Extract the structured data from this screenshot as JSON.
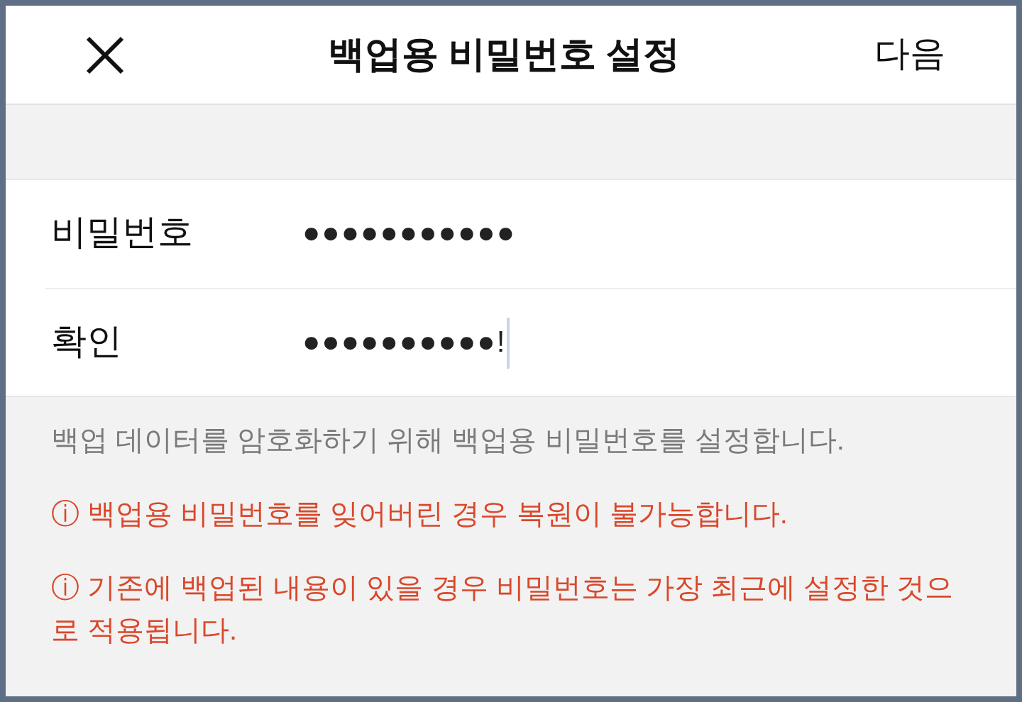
{
  "header": {
    "title": "백업용 비밀번호 설정",
    "action": "다음"
  },
  "fields": [
    {
      "label": "비밀번호",
      "value": "●●●●●●●●●●●",
      "focused": false
    },
    {
      "label": "확인",
      "value": "●●●●●●●●●●!",
      "focused": true
    }
  ],
  "notes": [
    {
      "kind": "info",
      "text": "백업 데이터를 암호화하기 위해 백업용 비밀번호를 설정합니다."
    },
    {
      "kind": "warning",
      "text": "ⓘ 백업용 비밀번호를 잊어버린 경우 복원이 불가능합니다."
    },
    {
      "kind": "warning",
      "text": "ⓘ 기존에 백업된 내용이 있을 경우 비밀번호는 가장 최근에 설정한 것으로 적용됩니다."
    }
  ]
}
